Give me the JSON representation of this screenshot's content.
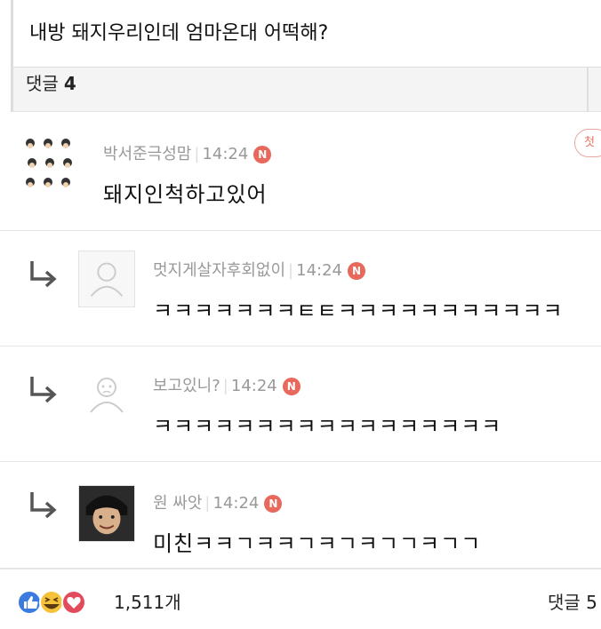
{
  "post": {
    "title": "내방 돼지우리인데 엄마온대 어떡해?"
  },
  "comments_header": {
    "label": "댓글",
    "count": "4"
  },
  "comments": [
    {
      "author": "박서준극성맘",
      "time": "14:24",
      "badge": "N",
      "text": "돼지인척하고있어",
      "first_label": "첫"
    },
    {
      "author": "멋지게살자후회없이",
      "time": "14:24",
      "badge": "N",
      "text": "ㅋㅋㅋㅋㅋㅋㅋㅌㅌㅋㅋㅋㅋㅋㅋㅋㅋㅋㅋㅋ"
    },
    {
      "author": "보고있니?",
      "time": "14:24",
      "badge": "N",
      "text": "ㅋㅋㅋㅋㅋㅋㅋㅋㅋㅋㅋㅋㅋㅋㅋㅋㅋ"
    },
    {
      "author": "원 싸앗",
      "time": "14:24",
      "badge": "N",
      "text": "미친ㅋㅋㄱㅋㅋㄱㅋㄱㅋㄱㄱㅋㄱㄱ"
    }
  ],
  "footer": {
    "reaction_count": "1,511개",
    "comment_label": "댓글 5"
  },
  "colors": {
    "badge": "#e8685c",
    "meta_text": "#999999",
    "like_blue": "#3b7be0",
    "haha_yellow": "#f5c33b",
    "heart_red": "#e24b5b"
  },
  "icons": [
    "reply-arrow-icon",
    "new-badge-icon",
    "like-icon",
    "haha-icon",
    "heart-icon",
    "default-avatar-icon"
  ]
}
